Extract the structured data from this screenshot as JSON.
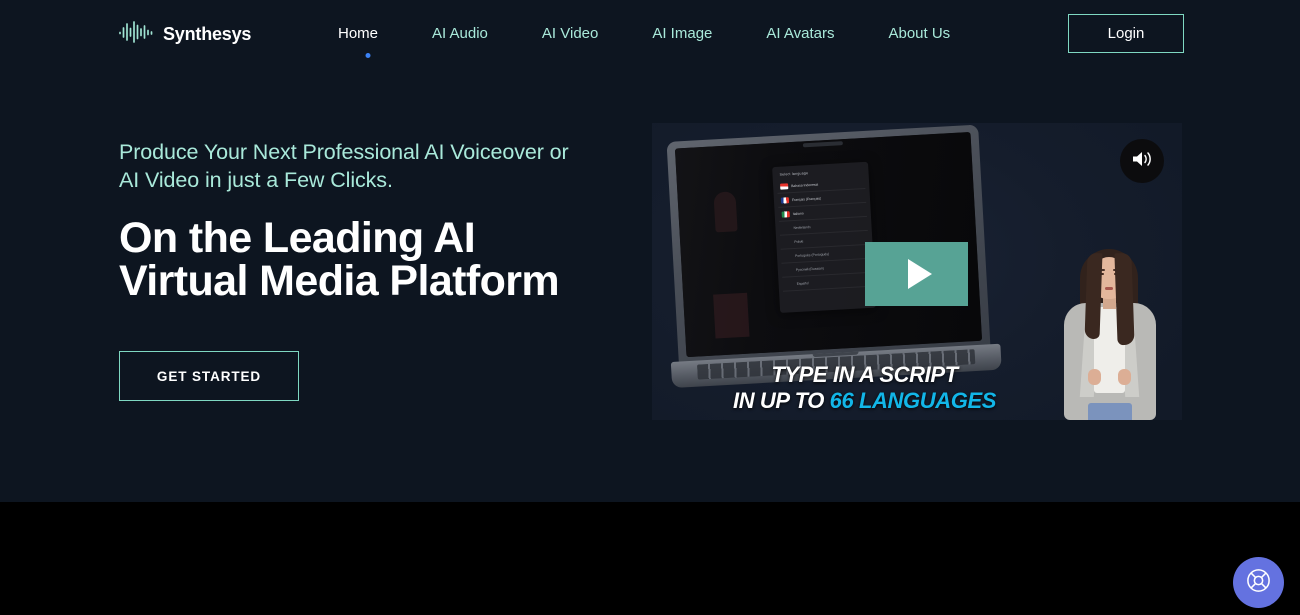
{
  "brand": {
    "name": "Synthesys",
    "logo_icon": "waveform-icon",
    "accent_color": "#7fd8c2"
  },
  "nav": {
    "items": [
      {
        "label": "Home",
        "active": true
      },
      {
        "label": "AI Audio",
        "active": false
      },
      {
        "label": "AI Video",
        "active": false
      },
      {
        "label": "AI Image",
        "active": false
      },
      {
        "label": "AI Avatars",
        "active": false
      },
      {
        "label": "About Us",
        "active": false
      }
    ],
    "active_dot_color": "#3b82f6",
    "login_label": "Login"
  },
  "hero": {
    "subtitle_line1": "Produce Your Next Professional AI Voiceover or",
    "subtitle_line2": "AI Video in just a Few Clicks.",
    "title_line1": "On the Leading AI",
    "title_line2": "Virtual Media Platform",
    "cta_label": "GET STARTED",
    "subtitle_color": "#a9e9da",
    "title_color": "#ffffff",
    "background_color": "#0d1520"
  },
  "video": {
    "play_icon": "play-icon",
    "play_button_color": "#57a395",
    "sound_icon": "volume-on-icon",
    "caption_line1": "TYPE IN A SCRIPT",
    "caption_line2_prefix": "IN UP TO ",
    "caption_line2_accent": "66 LANGUAGES",
    "accent_color": "#12b6e8",
    "laptop": {
      "dropdown_title": "Select language",
      "languages": [
        {
          "name": "Bahasa Indonesia",
          "flag": "flag-id"
        },
        {
          "name": "Français (Français)",
          "flag": "flag-fr"
        },
        {
          "name": "Italiano",
          "flag": "flag-it"
        },
        {
          "name": "Nederlands",
          "flag": ""
        },
        {
          "name": "Polski",
          "flag": ""
        },
        {
          "name": "Português (Português)",
          "flag": ""
        },
        {
          "name": "Русский (Russian)",
          "flag": ""
        },
        {
          "name": "Español",
          "flag": ""
        }
      ]
    }
  },
  "support": {
    "icon": "life-ring-icon",
    "color": "#6472e0"
  }
}
